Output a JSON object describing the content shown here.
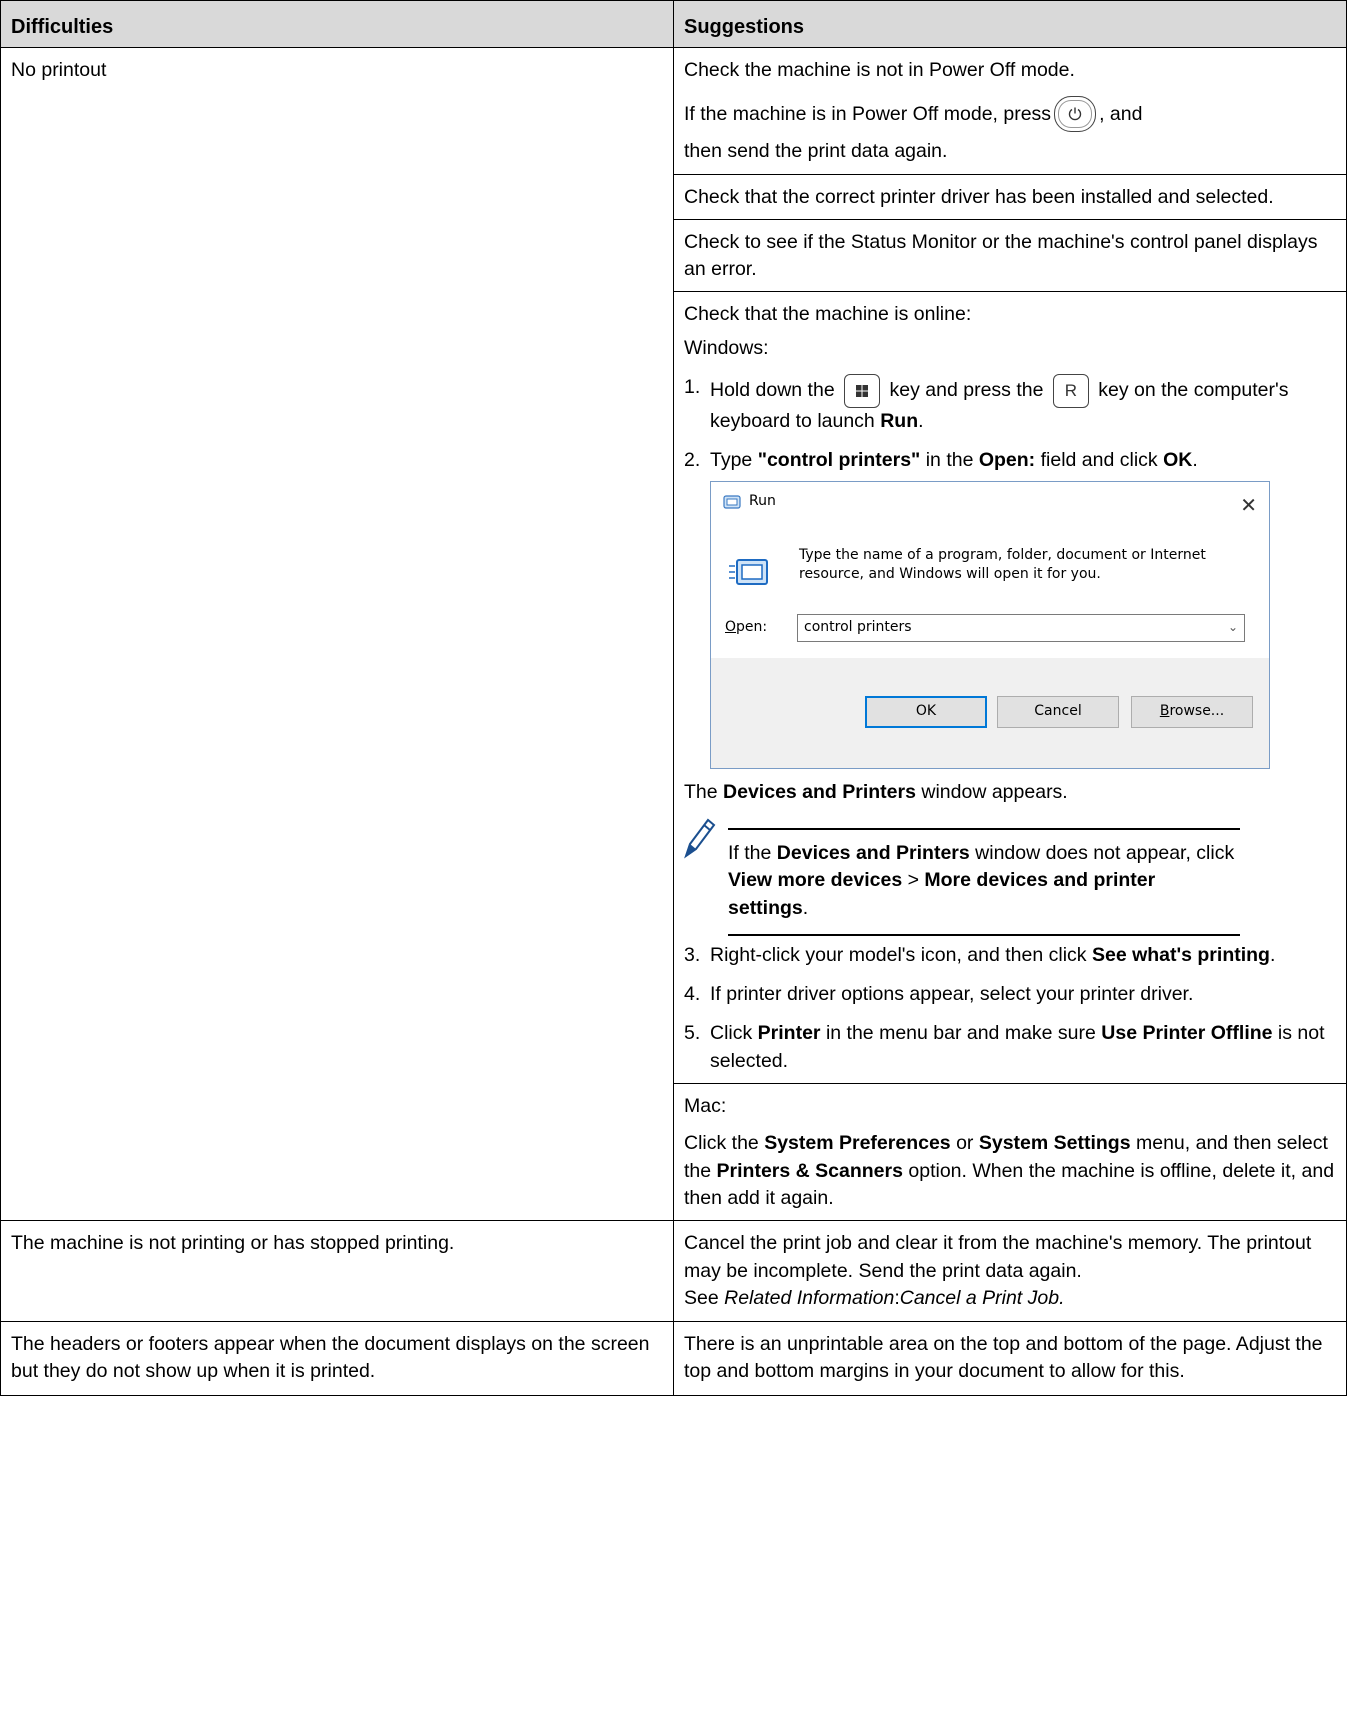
{
  "header": {
    "col1": "Difficulties",
    "col2": "Suggestions"
  },
  "row1": {
    "difficulty": "No printout",
    "s1_line1": "Check the machine is not in Power Off mode.",
    "s1_line2a": "If the machine is in Power Off mode, press",
    "s1_line2b": ", and",
    "s1_line3": "then send the print data again.",
    "s2": "Check that the correct printer driver has been installed and selected.",
    "s3": "Check to see if the Status Monitor or the machine's control panel displays an error.",
    "s4_intro": "Check that the machine is online:",
    "s4_windows": "Windows:",
    "step1": {
      "num": "1.",
      "a": "Hold down the",
      "b": "key and press the",
      "key_r": "R",
      "c": "key on the computer's keyboard to launch",
      "run": "Run",
      "end": "."
    },
    "step2": {
      "num": "2.",
      "a": "Type",
      "cmd": "\"control printers\"",
      "b": "in the",
      "open": "Open:",
      "c": "field and click",
      "ok": "OK",
      "end": "."
    },
    "runwin": {
      "title": "Run",
      "description": "Type the name of a program, folder, document or Internet resource, and Windows will open it for you.",
      "open_label_u": "O",
      "open_label_rest": "pen:",
      "open_value": "control printers",
      "ok": "OK",
      "cancel": "Cancel",
      "browse_u": "B",
      "browse_rest": "rowse..."
    },
    "after_run": {
      "a": "The",
      "b": "Devices and Printers",
      "c": "window appears."
    },
    "note": {
      "a": "If the",
      "b": "Devices and Printers",
      "c": "window does not appear, click",
      "d": "View more devices",
      "e": ">",
      "f": "More devices and printer settings",
      "g": "."
    },
    "step3": {
      "num": "3.",
      "a": "Right-click your model's icon, and then click",
      "b": "See what's printing",
      "c": "."
    },
    "step4": {
      "num": "4.",
      "a": "If printer driver options appear, select your printer driver."
    },
    "step5": {
      "num": "5.",
      "a": "Click",
      "b": "Printer",
      "c": "in the menu bar and make sure",
      "d": "Use Printer Offline",
      "e": "is not selected."
    },
    "mac": {
      "label": "Mac:",
      "a": "Click the",
      "b": "System Preferences",
      "c": "or",
      "d": "System Settings",
      "e": "menu, and then select the",
      "f": "Printers & Scanners",
      "g": "option. When the machine is offline, delete it, and then add it again."
    }
  },
  "row2": {
    "difficulty": "The machine is not printing or has stopped printing.",
    "suggestion": "Cancel the print job and clear it from the machine's memory. The printout may be incomplete. Send the print data again.",
    "see": "See",
    "related": "Related Information",
    "colon": ":",
    "link": "Cancel a Print Job."
  },
  "row3": {
    "difficulty": "The headers or footers appear when the document displays on the screen but they do not show up when it is printed.",
    "suggestion": "There is an unprintable area on the top and bottom of the page. Adjust the top and bottom margins in your document to allow for this."
  },
  "icons": {
    "power": "power-button-icon",
    "windows_key": "windows-key-icon",
    "run_title": "run-window-icon",
    "run_big": "run-program-icon",
    "note": "pencil-note-icon",
    "close": "close-icon"
  }
}
